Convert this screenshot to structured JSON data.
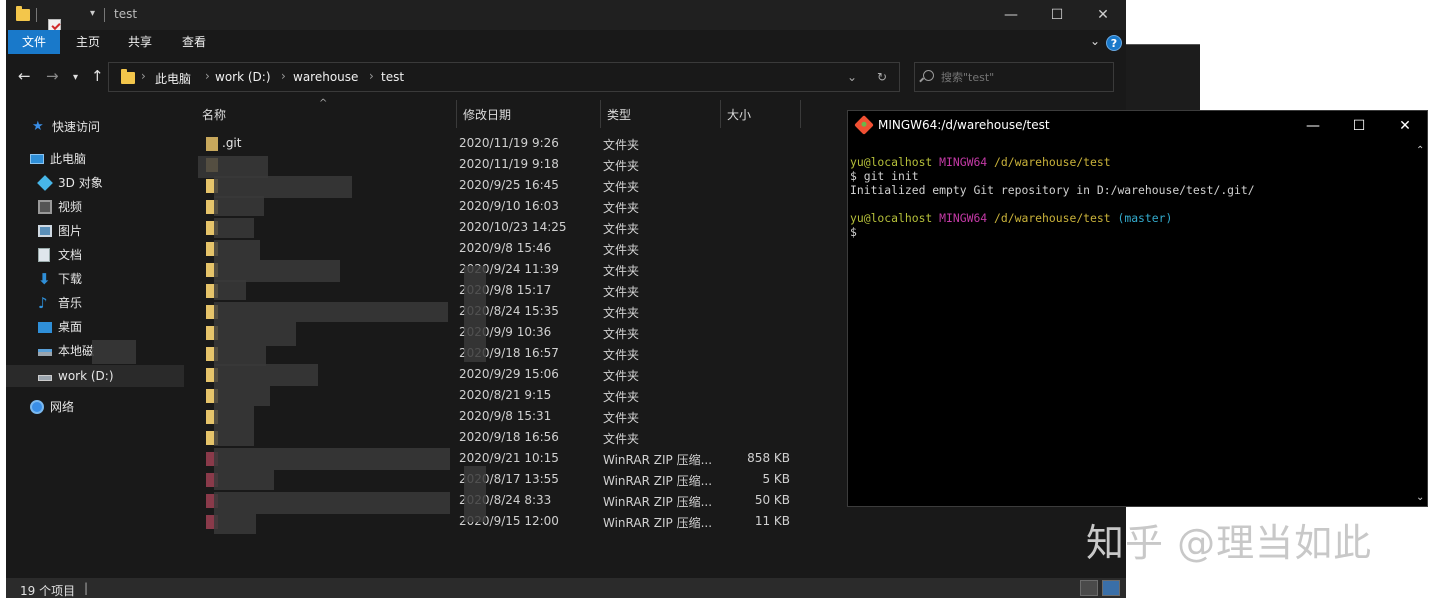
{
  "explorer": {
    "title": "test",
    "ribbon_tabs": [
      "文件",
      "主页",
      "共享",
      "查看"
    ],
    "address": {
      "crumbs": [
        "此电脑",
        "work (D:)",
        "warehouse",
        "test"
      ]
    },
    "search_placeholder": "搜索\"test\"",
    "sidebar": {
      "quick_access": "快速访问",
      "this_pc": "此电脑",
      "objects_3d": "3D 对象",
      "videos": "视频",
      "pictures": "图片",
      "documents": "文档",
      "downloads": "下载",
      "music": "音乐",
      "desktop": "桌面",
      "local_disk": "本地磁",
      "work_drive": "work (D:)",
      "network": "网络"
    },
    "columns": {
      "name": "名称",
      "date": "修改日期",
      "type": "类型",
      "size": "大小"
    },
    "files": [
      {
        "name": ".git",
        "date": "2020/11/19 9:26",
        "type": "文件夹",
        "size": ""
      },
      {
        "name": "",
        "date": "2020/11/19 9:18",
        "type": "文件夹",
        "size": ""
      },
      {
        "name": "",
        "date": "2020/9/25 16:45",
        "type": "文件夹",
        "size": ""
      },
      {
        "name": "",
        "date": "2020/9/10 16:03",
        "type": "文件夹",
        "size": ""
      },
      {
        "name": "",
        "date": "2020/10/23 14:25",
        "type": "文件夹",
        "size": ""
      },
      {
        "name": "",
        "date": "2020/9/8 15:46",
        "type": "文件夹",
        "size": ""
      },
      {
        "name": "",
        "date": "2020/9/24 11:39",
        "type": "文件夹",
        "size": ""
      },
      {
        "name": "",
        "date": "2020/9/8 15:17",
        "type": "文件夹",
        "size": ""
      },
      {
        "name": "",
        "date": "2020/8/24 15:35",
        "type": "文件夹",
        "size": ""
      },
      {
        "name": "",
        "date": "2020/9/9 10:36",
        "type": "文件夹",
        "size": ""
      },
      {
        "name": "",
        "date": "2020/9/18 16:57",
        "type": "文件夹",
        "size": ""
      },
      {
        "name": "",
        "date": "2020/9/29 15:06",
        "type": "文件夹",
        "size": ""
      },
      {
        "name": "",
        "date": "2020/8/21 9:15",
        "type": "文件夹",
        "size": ""
      },
      {
        "name": "",
        "date": "2020/9/8 15:31",
        "type": "文件夹",
        "size": ""
      },
      {
        "name": "",
        "date": "2020/9/18 16:56",
        "type": "文件夹",
        "size": ""
      },
      {
        "name": "",
        "date": "2020/9/21 10:15",
        "type": "WinRAR ZIP 压缩...",
        "size": "858 KB"
      },
      {
        "name": "",
        "date": "2020/8/17 13:55",
        "type": "WinRAR ZIP 压缩...",
        "size": "5 KB"
      },
      {
        "name": "",
        "date": "2020/8/24 8:33",
        "type": "WinRAR ZIP 压缩...",
        "size": "50 KB"
      },
      {
        "name": "",
        "date": "2020/9/15 12:00",
        "type": "WinRAR ZIP 压缩...",
        "size": "11 KB"
      }
    ],
    "status": "19 个项目"
  },
  "terminal": {
    "title": "MINGW64:/d/warehouse/test",
    "user": "yu@localhost",
    "host": "MINGW64",
    "path": "/d/warehouse/test",
    "cmd1": "$ git init",
    "out1": "Initialized empty Git repository in D:/warehouse/test/.git/",
    "branch": "(master)",
    "prompt": "$"
  },
  "watermark": "知乎 @理当如此",
  "colors": {
    "accent": "#1979ca",
    "folder": "#f3c64b",
    "term_user": "#b5bf3a",
    "term_host": "#c43aa6",
    "term_path": "#c9b23a",
    "term_branch": "#33aacc"
  }
}
